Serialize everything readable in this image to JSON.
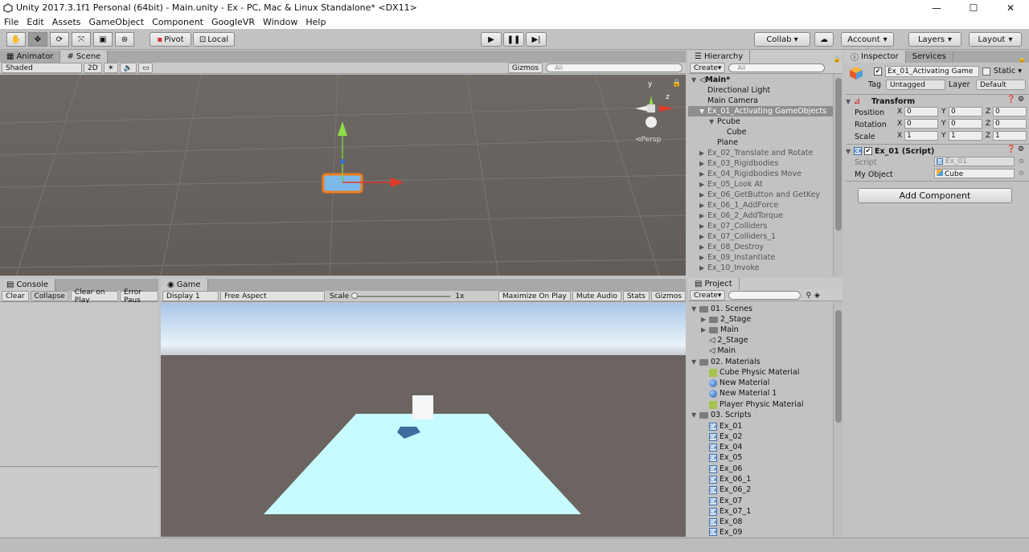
{
  "window": {
    "title": "Unity 2017.3.1f1 Personal (64bit) - Main.unity - Ex - PC, Mac & Linux Standalone* <DX11>",
    "minimize": "—",
    "maximize": "☐",
    "close": "✕"
  },
  "menu": [
    "File",
    "Edit",
    "Assets",
    "GameObject",
    "Component",
    "GoogleVR",
    "Window",
    "Help"
  ],
  "toolbar": {
    "pivot": "Pivot",
    "local": "Local",
    "collab": "Collab ▾",
    "account": "Account",
    "layers": "Layers",
    "layout": "Layout"
  },
  "scene": {
    "tabs": [
      "Animator",
      "Scene"
    ],
    "shading": "Shaded",
    "mode2d": "2D",
    "gizmos": "Gizmos",
    "search_placeholder": "All",
    "persp": "Persp",
    "gizmo_axes": {
      "y": "y",
      "z": "z"
    }
  },
  "console": {
    "tab": "Console",
    "buttons": [
      "Clear",
      "Collapse",
      "Clear on Play",
      "Error Paus"
    ]
  },
  "game": {
    "tab": "Game",
    "display": "Display 1",
    "aspect": "Free Aspect",
    "scale_label": "Scale",
    "scale_value": "1x",
    "buttons": [
      "Maximize On Play",
      "Mute Audio",
      "Stats",
      "Gizmos"
    ]
  },
  "hierarchy": {
    "tab": "Hierarchy",
    "create": "Create",
    "search_placeholder": "All",
    "scene": "Main*",
    "items": [
      "Directional Light",
      "Main Camera",
      "Ex_01_Activating GameObjects",
      "Pcube",
      "Cube",
      "Plane",
      "Ex_02_Translate and Rotate",
      "Ex_03_Rigidbodies",
      "Ex_04_Rigidbodies Move",
      "Ex_05_Look At",
      "Ex_06_GetButton and GetKey",
      "Ex_06_1_AddForce",
      "Ex_06_2_AddTorque",
      "Ex_07_Colliders",
      "Ex_07_Colliders_1",
      "Ex_08_Destroy",
      "Ex_09_Instantiate",
      "Ex_10_Invoke"
    ]
  },
  "project": {
    "tab": "Project",
    "create": "Create",
    "items": [
      "01. Scenes",
      "2_Stage",
      "Main",
      "2_Stage",
      "Main",
      "02. Materials",
      "Cube Physic Material",
      "New Material",
      "New Material 1",
      "Player Physic Material",
      "03. Scripts",
      "Ex_01",
      "Ex_02",
      "Ex_04",
      "Ex_05",
      "Ex_06",
      "Ex_06_1",
      "Ex_06_2",
      "Ex_07",
      "Ex_07_1",
      "Ex_08",
      "Ex_09"
    ]
  },
  "inspector": {
    "tabs": [
      "Inspector",
      "Services"
    ],
    "object_name": "Ex_01_Activating Game",
    "static": "Static",
    "tag_label": "Tag",
    "tag": "Untagged",
    "layer_label": "Layer",
    "layer": "Default",
    "transform": {
      "title": "Transform",
      "position": {
        "label": "Position",
        "x": "0",
        "y": "0",
        "z": "0"
      },
      "rotation": {
        "label": "Rotation",
        "x": "0",
        "y": "0",
        "z": "0"
      },
      "scale": {
        "label": "Scale",
        "x": "1",
        "y": "1",
        "z": "1"
      }
    },
    "script": {
      "title": "Ex_01 (Script)",
      "script_label": "Script",
      "script_value": "Ex_01",
      "obj_label": "My Object",
      "obj_value": "Cube"
    },
    "add_component": "Add Component",
    "axes": {
      "x": "X",
      "y": "Y",
      "z": "Z"
    }
  },
  "colors": {
    "sky_top": "#b9d2ef",
    "ground": "#6b6460",
    "plane": "#c7fbff",
    "selection": "#f07d1c",
    "play_active": "#4a7ab8"
  }
}
